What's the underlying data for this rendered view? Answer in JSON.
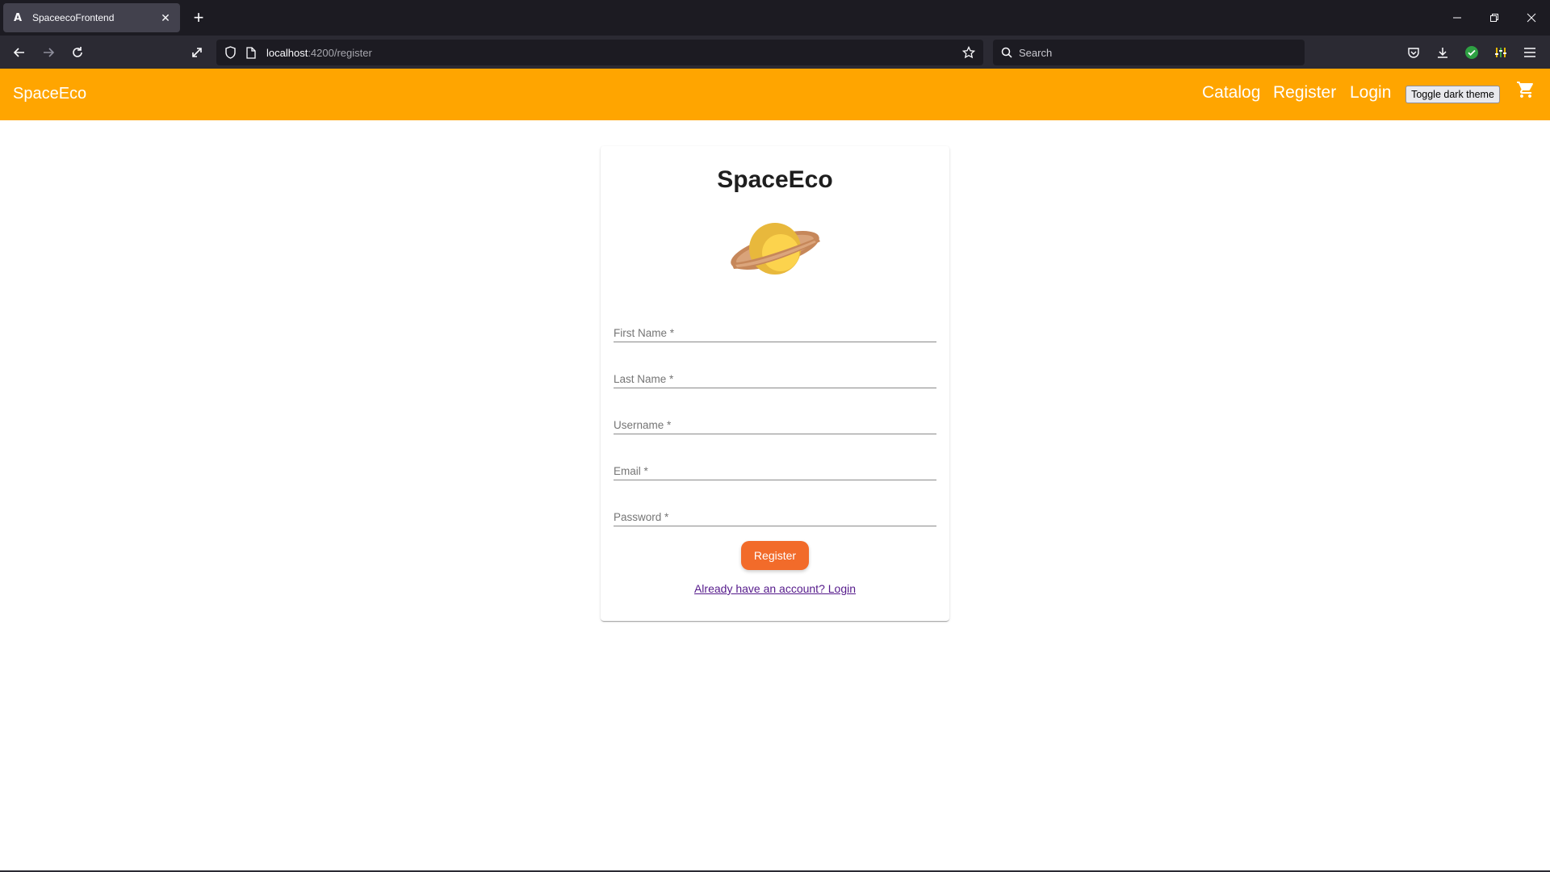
{
  "browser": {
    "tab_title": "SpaceecoFrontend",
    "tab_favicon": "A",
    "url_host": "localhost",
    "url_path": ":4200/register",
    "search_placeholder": "Search"
  },
  "app": {
    "brand": "SpaceEco",
    "nav": {
      "catalog": "Catalog",
      "register": "Register",
      "login": "Login"
    },
    "toggle_theme_label": "Toggle dark theme"
  },
  "form": {
    "title": "SpaceEco",
    "fields": {
      "first_name": {
        "label": "First Name *",
        "value": ""
      },
      "last_name": {
        "label": "Last Name *",
        "value": ""
      },
      "username": {
        "label": "Username *",
        "value": ""
      },
      "email": {
        "label": "Email *",
        "value": ""
      },
      "password": {
        "label": "Password *",
        "value": ""
      }
    },
    "submit_label": "Register",
    "login_link": "Already have an account? Login"
  },
  "colors": {
    "toolbar": "#ffa500",
    "primary_button": "#f26b2a",
    "link": "#551a8b"
  }
}
